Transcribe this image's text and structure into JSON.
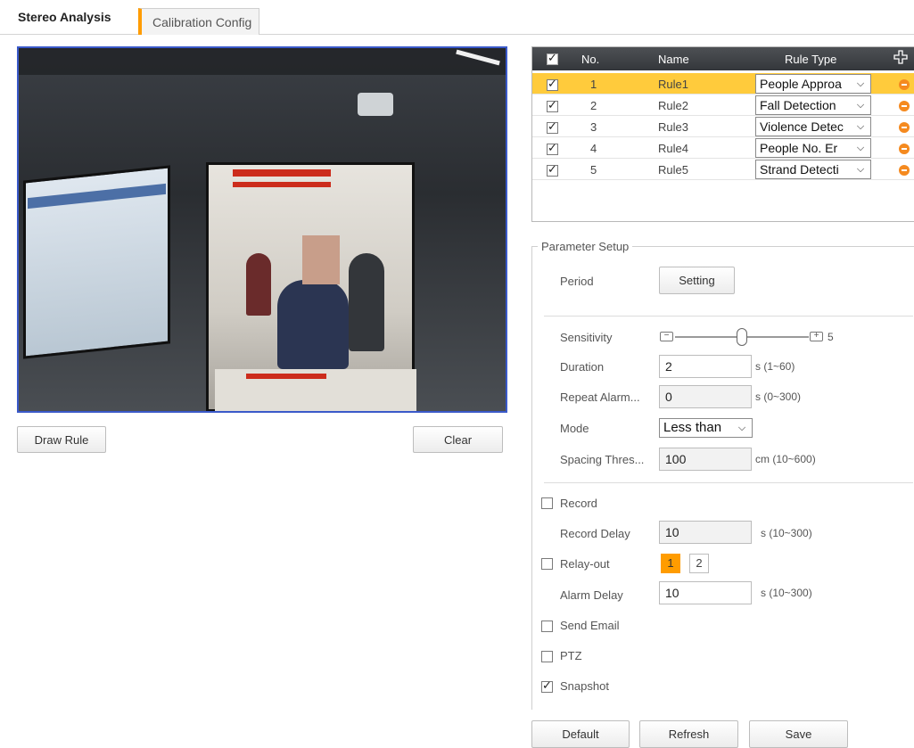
{
  "tabs": [
    {
      "label": "Stereo Analysis",
      "active": true
    },
    {
      "label": "Calibration Config",
      "active": false
    }
  ],
  "video": {
    "draw_rule_label": "Draw Rule",
    "clear_label": "Clear"
  },
  "rules": {
    "header": {
      "no": "No.",
      "name": "Name",
      "rule_type": "Rule Type",
      "add_icon": "plus-icon"
    },
    "rows": [
      {
        "no": "1",
        "name": "Rule1",
        "type": "People Approa",
        "checked": true,
        "selected": true
      },
      {
        "no": "2",
        "name": "Rule2",
        "type": "Fall Detection",
        "checked": true,
        "selected": false
      },
      {
        "no": "3",
        "name": "Rule3",
        "type": "Violence Detec",
        "checked": true,
        "selected": false
      },
      {
        "no": "4",
        "name": "Rule4",
        "type": "People No. Er",
        "checked": true,
        "selected": false
      },
      {
        "no": "5",
        "name": "Rule5",
        "type": "Strand Detecti",
        "checked": true,
        "selected": false
      }
    ]
  },
  "param": {
    "legend": "Parameter Setup",
    "period_label": "Period",
    "setting_label": "Setting",
    "sensitivity_label": "Sensitivity",
    "sensitivity_value": "5",
    "sensitivity_level": 0.5,
    "duration_label": "Duration",
    "duration_value": "2",
    "duration_unit": "s (1~60)",
    "repeat_label": "Repeat Alarm...",
    "repeat_value": "0",
    "repeat_unit": "s (0~300)",
    "mode_label": "Mode",
    "mode_value": "Less than",
    "spacing_label": "Spacing Thres...",
    "spacing_value": "100",
    "spacing_unit": "cm (10~600)",
    "record_label": "Record",
    "record_checked": false,
    "record_delay_label": "Record Delay",
    "record_delay_value": "10",
    "record_delay_unit": "s (10~300)",
    "relay_label": "Relay-out",
    "relay_checked": false,
    "relay_1": "1",
    "relay_2": "2",
    "alarm_delay_label": "Alarm Delay",
    "alarm_delay_value": "10",
    "alarm_delay_unit": "s (10~300)",
    "email_label": "Send Email",
    "email_checked": false,
    "ptz_label": "PTZ",
    "ptz_checked": false,
    "snapshot_label": "Snapshot",
    "snapshot_checked": true
  },
  "footer": {
    "default_label": "Default",
    "refresh_label": "Refresh",
    "save_label": "Save"
  },
  "colors": {
    "accent": "#ff9c00",
    "selected_row": "#ffcb3c",
    "header_bg": "#3f4246",
    "video_border": "#3a59c9",
    "delete_icon": "#f58a1f"
  }
}
